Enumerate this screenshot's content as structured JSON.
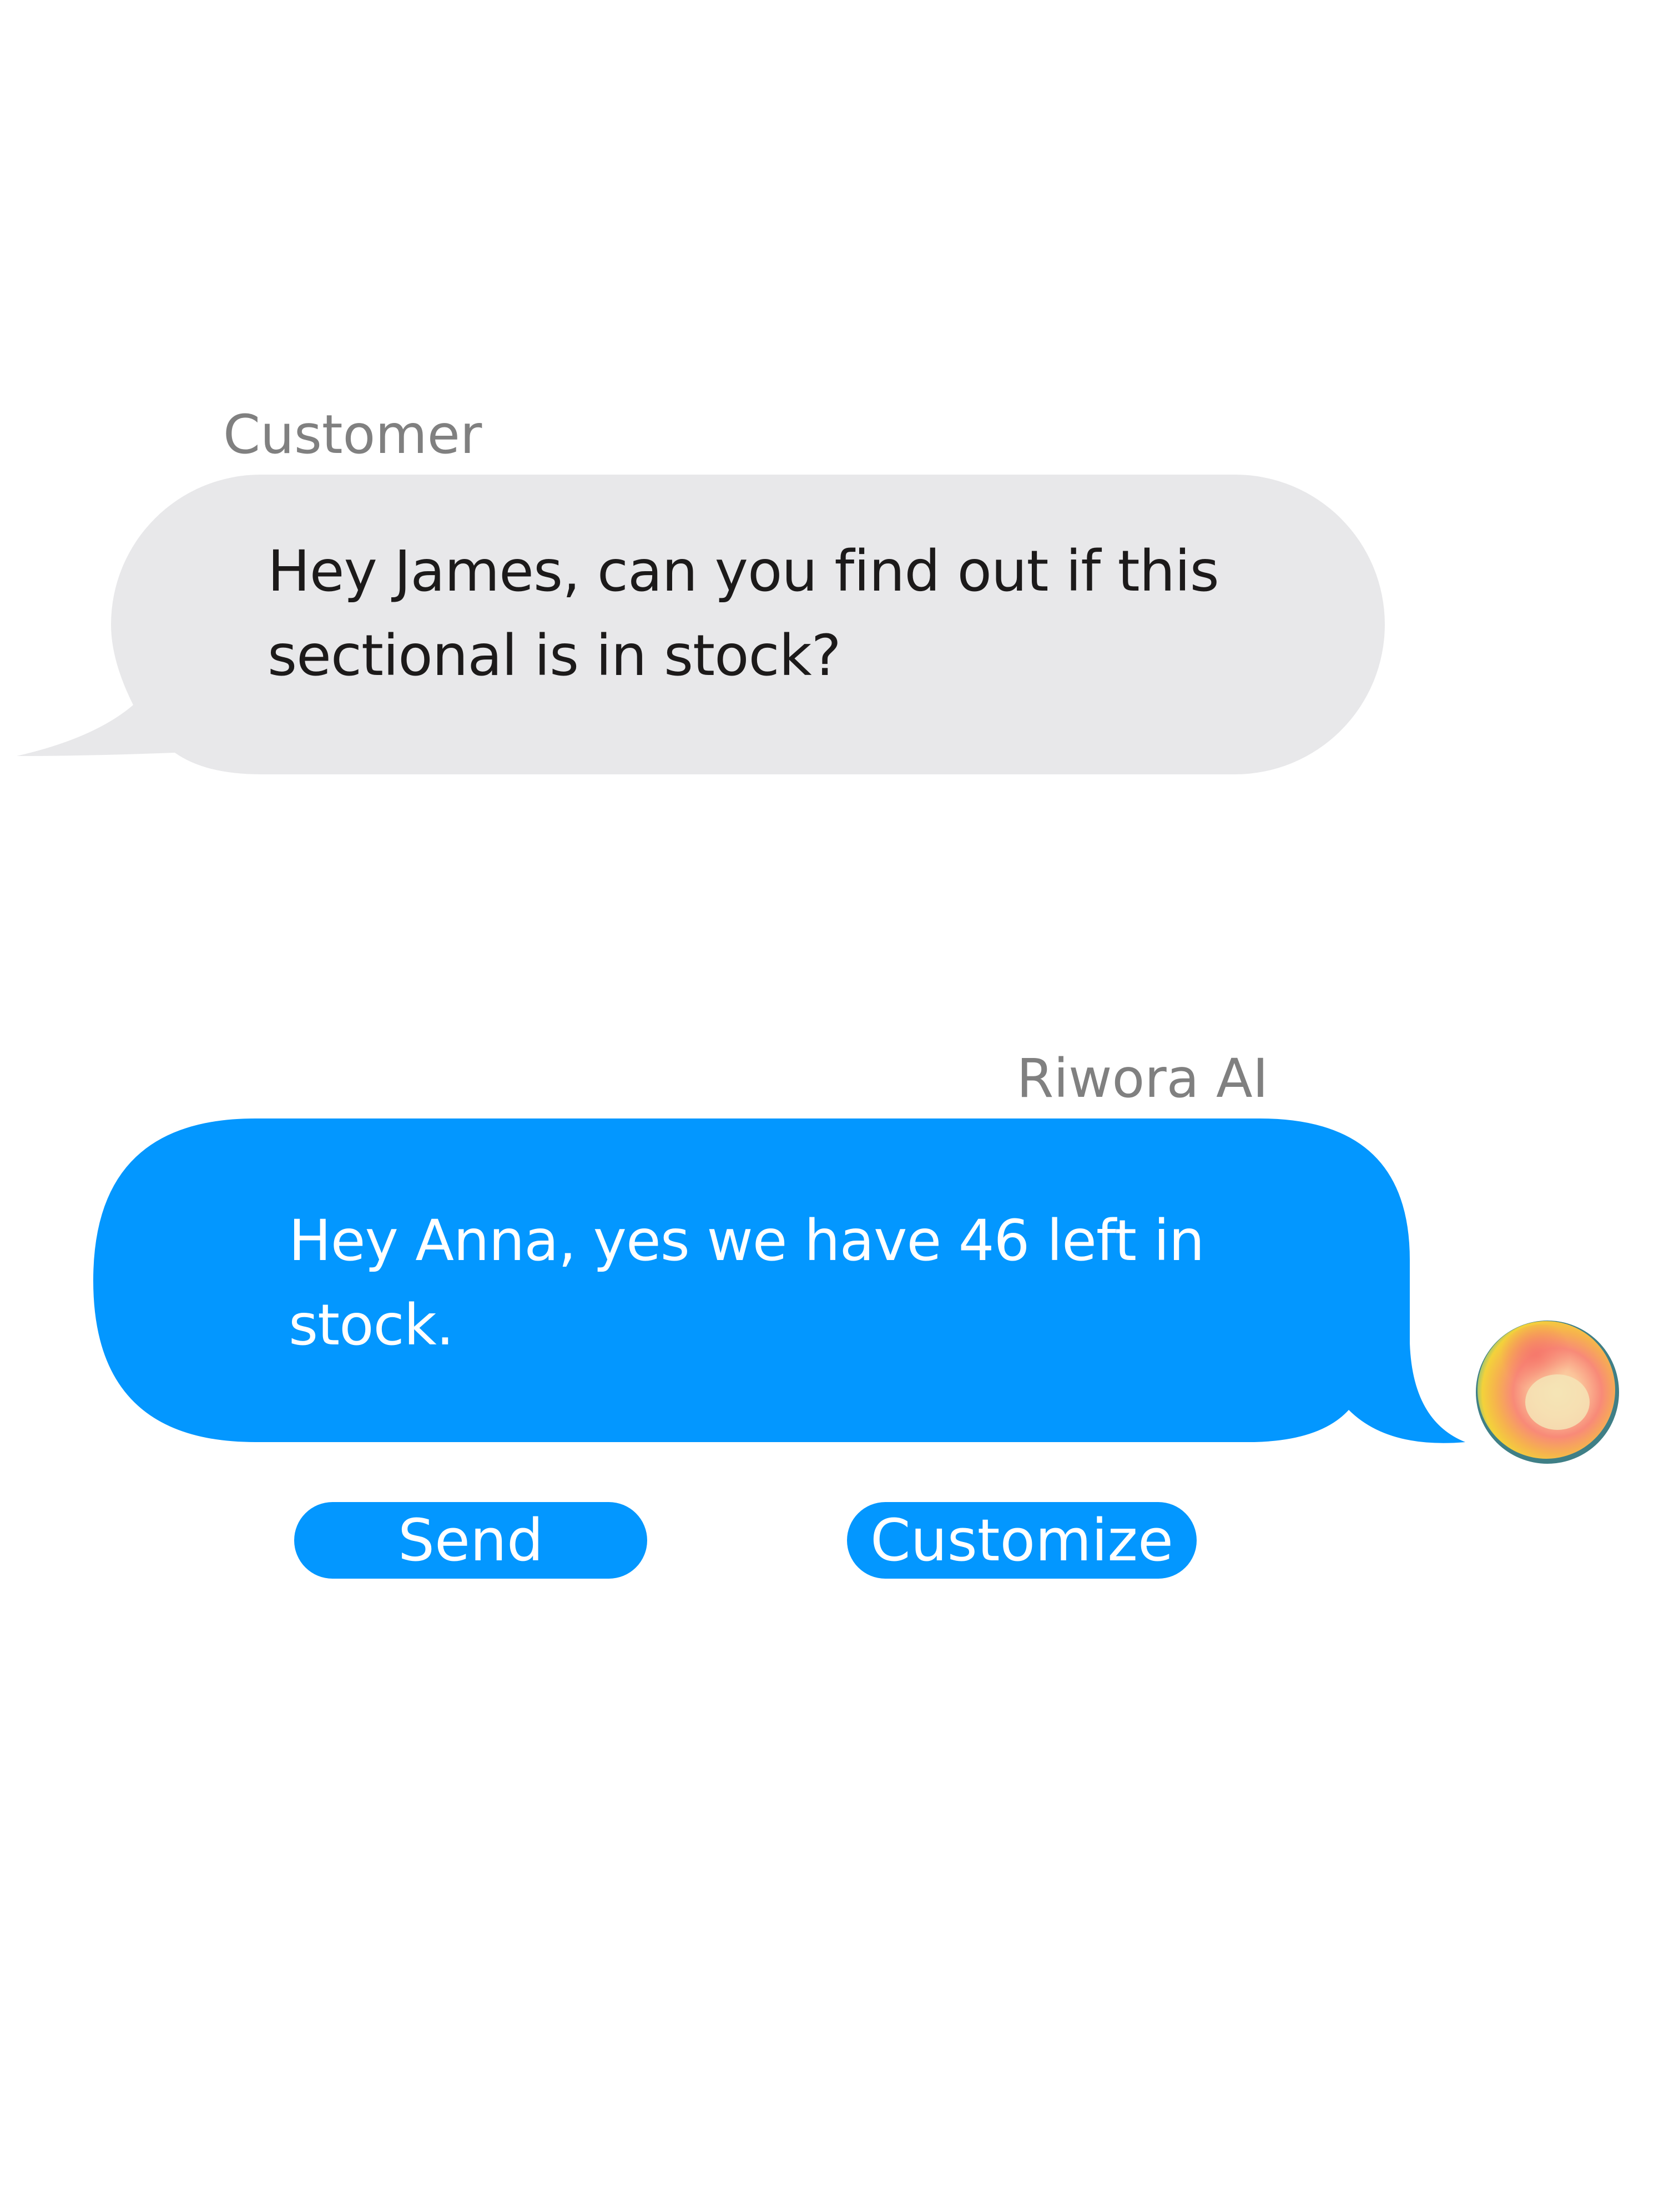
{
  "conversation": {
    "customer": {
      "sender": "Customer",
      "message": "Hey James, can you find out if this sectional is in stock?"
    },
    "assistant": {
      "sender": "Riwora AI",
      "message": "Hey Anna, yes we have 46 left in stock."
    }
  },
  "actions": {
    "send_label": "Send",
    "customize_label": "Customize"
  },
  "icons": {
    "avatar": "gradient-orb-icon"
  },
  "colors": {
    "customer_bubble": "#e8e8ea",
    "assistant_bubble": "#0397ff",
    "button": "#0397ff",
    "label_gray": "#808080",
    "dark_text": "#1c1a1a"
  }
}
